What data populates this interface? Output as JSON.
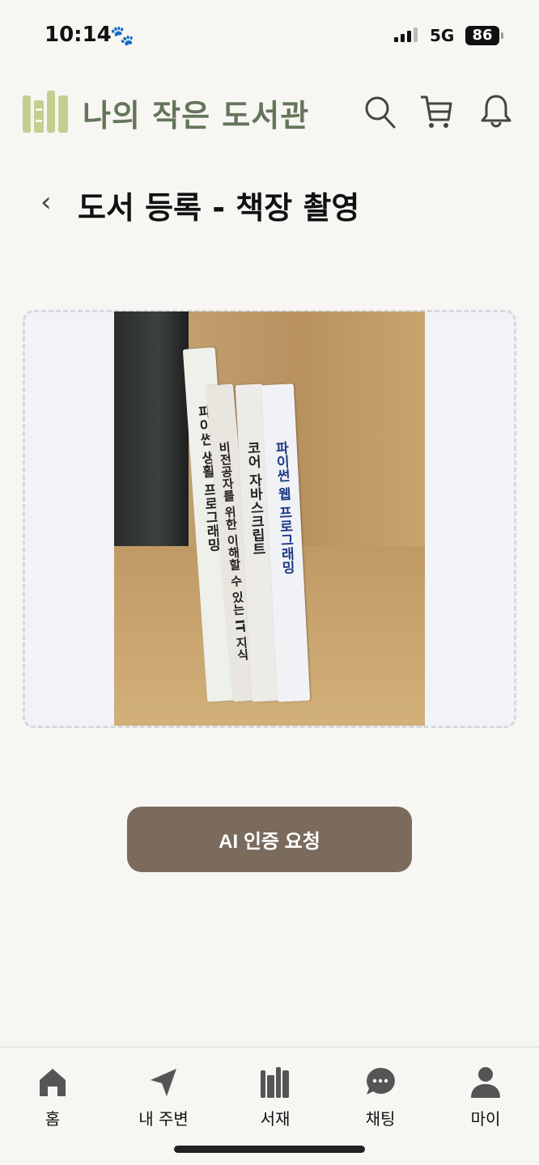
{
  "status_bar": {
    "time": "10:14",
    "network": "5G",
    "battery": "86"
  },
  "header": {
    "app_title": "나의 작은 도서관",
    "icons": [
      "search-icon",
      "cart-icon",
      "bell-icon"
    ]
  },
  "page": {
    "title": "도서 등록 - 책장 촬영"
  },
  "photo": {
    "books": [
      "파이썬 생활 프로그래밍",
      "비전공자를 위한 이해할 수 있는 IT 지식",
      "코어 자바스크립트",
      "파이썬 웹 프로그래밍"
    ]
  },
  "action": {
    "label": "AI 인증 요청"
  },
  "nav": {
    "items": [
      {
        "label": "홈",
        "icon": "home-icon"
      },
      {
        "label": "내 주변",
        "icon": "location-arrow-icon"
      },
      {
        "label": "서재",
        "icon": "bookshelf-icon"
      },
      {
        "label": "채팅",
        "icon": "chat-icon"
      },
      {
        "label": "마이",
        "icon": "user-icon"
      }
    ]
  },
  "colors": {
    "brand_green": "#64765a",
    "logo_light": "#c3cf8f",
    "button": "#7a6b5c",
    "background": "#f7f6f3"
  }
}
